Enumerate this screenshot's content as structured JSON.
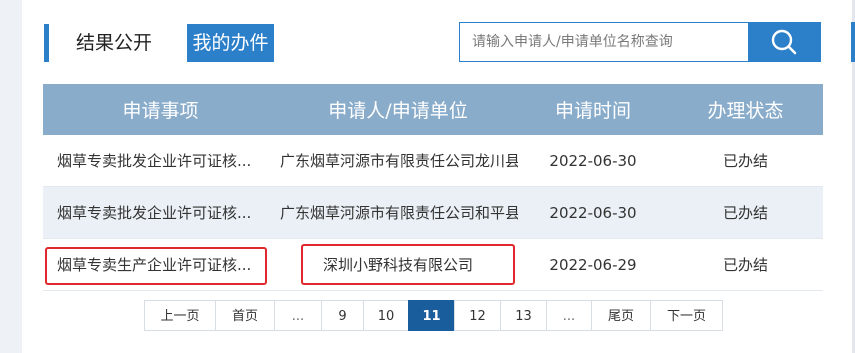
{
  "tabs": {
    "results": "结果公开",
    "mine": "我的办件"
  },
  "search": {
    "placeholder": "请输入申请人/申请单位名称查询",
    "icon": "search-icon"
  },
  "table": {
    "headers": [
      "申请事项",
      "申请人/申请单位",
      "申请时间",
      "办理状态"
    ],
    "rows": [
      {
        "item": "烟草专卖批发企业许可证核...",
        "applicant": "广东烟草河源市有限责任公司龙川县...",
        "date": "2022-06-30",
        "status": "已办结"
      },
      {
        "item": "烟草专卖批发企业许可证核...",
        "applicant": "广东烟草河源市有限责任公司和平县...",
        "date": "2022-06-30",
        "status": "已办结"
      },
      {
        "item": "烟草专卖生产企业许可证核...",
        "applicant": "深圳小野科技有限公司",
        "date": "2022-06-29",
        "status": "已办结"
      }
    ]
  },
  "pagination": {
    "prev": "上一页",
    "first": "首页",
    "dots": "...",
    "pages": [
      "9",
      "10",
      "11",
      "12",
      "13"
    ],
    "current": "11",
    "last": "尾页",
    "next": "下一页"
  },
  "colors": {
    "accent": "#2c7fc9",
    "header_bg": "#8aaccb",
    "highlight": "#e0282e",
    "active_page": "#195d9c"
  }
}
